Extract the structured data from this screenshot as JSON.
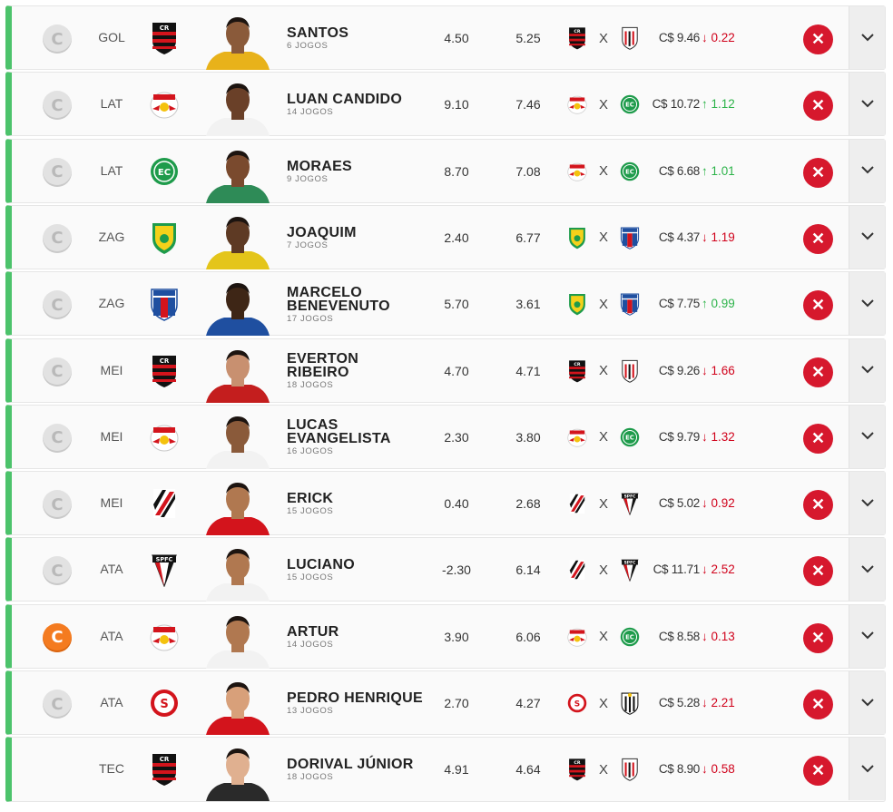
{
  "accent_color": "#4cc36b",
  "players": [
    {
      "pos": "GOL",
      "team": "flamengo",
      "name": "SANTOS",
      "games": "6 JOGOS",
      "v1": "4.50",
      "v2": "5.25",
      "home": "flamengo",
      "vs": "X",
      "away": "atletico-go",
      "price": "C$ 9.46",
      "variation": "0.22",
      "dir": "down",
      "captain": "off",
      "shirt": "#e8b21a",
      "skin": "#8a5a3a"
    },
    {
      "pos": "LAT",
      "team": "bragantino",
      "name": "LUAN CANDIDO",
      "games": "14 JOGOS",
      "v1": "9.10",
      "v2": "7.46",
      "home": "bragantino",
      "vs": "X",
      "away": "juventude",
      "price": "C$ 10.72",
      "variation": "1.12",
      "dir": "up",
      "captain": "off",
      "shirt": "#f2f2f2",
      "skin": "#6a4028"
    },
    {
      "pos": "LAT",
      "team": "juventude",
      "name": "MORAES",
      "games": "9 JOGOS",
      "v1": "8.70",
      "v2": "7.08",
      "home": "bragantino",
      "vs": "X",
      "away": "juventude",
      "price": "C$ 6.68",
      "variation": "1.01",
      "dir": "up",
      "captain": "off",
      "shirt": "#2e8b57",
      "skin": "#7a4a2e"
    },
    {
      "pos": "ZAG",
      "team": "cuiaba",
      "name": "JOAQUIM",
      "games": "7 JOGOS",
      "v1": "2.40",
      "v2": "6.77",
      "home": "cuiaba",
      "vs": "X",
      "away": "fortaleza",
      "price": "C$ 4.37",
      "variation": "1.19",
      "dir": "down",
      "captain": "off",
      "shirt": "#e4c51a",
      "skin": "#5e3a24"
    },
    {
      "pos": "ZAG",
      "team": "fortaleza",
      "name": "MARCELO BENEVENUTO",
      "games": "17 JOGOS",
      "v1": "5.70",
      "v2": "3.61",
      "home": "cuiaba",
      "vs": "X",
      "away": "fortaleza",
      "price": "C$ 7.75",
      "variation": "0.99",
      "dir": "up",
      "captain": "off",
      "shirt": "#1f4fa0",
      "skin": "#3e2616"
    },
    {
      "pos": "MEI",
      "team": "flamengo",
      "name": "EVERTON RIBEIRO",
      "games": "18 JOGOS",
      "v1": "4.70",
      "v2": "4.71",
      "home": "flamengo",
      "vs": "X",
      "away": "atletico-go",
      "price": "C$ 9.26",
      "variation": "1.66",
      "dir": "down",
      "captain": "off",
      "shirt": "#c41e1e",
      "skin": "#c89070"
    },
    {
      "pos": "MEI",
      "team": "bragantino",
      "name": "LUCAS EVANGELISTA",
      "games": "16 JOGOS",
      "v1": "2.30",
      "v2": "3.80",
      "home": "bragantino",
      "vs": "X",
      "away": "juventude",
      "price": "C$ 9.79",
      "variation": "1.32",
      "dir": "down",
      "captain": "off",
      "shirt": "#f2f2f2",
      "skin": "#8a5a3a"
    },
    {
      "pos": "MEI",
      "team": "athletico-pr",
      "name": "ERICK",
      "games": "15 JOGOS",
      "v1": "0.40",
      "v2": "2.68",
      "home": "athletico-pr",
      "vs": "X",
      "away": "sao-paulo",
      "price": "C$ 5.02",
      "variation": "0.92",
      "dir": "down",
      "captain": "off",
      "shirt": "#d3141c",
      "skin": "#b07850"
    },
    {
      "pos": "ATA",
      "team": "sao-paulo",
      "name": "LUCIANO",
      "games": "15 JOGOS",
      "v1": "-2.30",
      "v2": "6.14",
      "home": "athletico-pr",
      "vs": "X",
      "away": "sao-paulo",
      "price": "C$ 11.71",
      "variation": "2.52",
      "dir": "down",
      "captain": "off",
      "shirt": "#f2f2f2",
      "skin": "#b07850"
    },
    {
      "pos": "ATA",
      "team": "bragantino",
      "name": "ARTUR",
      "games": "14 JOGOS",
      "v1": "3.90",
      "v2": "6.06",
      "home": "bragantino",
      "vs": "X",
      "away": "juventude",
      "price": "C$ 8.58",
      "variation": "0.13",
      "dir": "down",
      "captain": "on",
      "shirt": "#f2f2f2",
      "skin": "#b07850"
    },
    {
      "pos": "ATA",
      "team": "internacional",
      "name": "PEDRO HENRIQUE",
      "games": "13 JOGOS",
      "v1": "2.70",
      "v2": "4.27",
      "home": "internacional",
      "vs": "X",
      "away": "atletico-mg",
      "price": "C$ 5.28",
      "variation": "2.21",
      "dir": "down",
      "captain": "off",
      "shirt": "#d3141c",
      "skin": "#d8a07a"
    },
    {
      "pos": "TEC",
      "team": "flamengo",
      "name": "DORIVAL JÚNIOR",
      "games": "18 JOGOS",
      "v1": "4.91",
      "v2": "4.64",
      "home": "flamengo",
      "vs": "X",
      "away": "atletico-go",
      "price": "C$ 8.90",
      "variation": "0.58",
      "dir": "down",
      "captain": "none",
      "shirt": "#2a2a2a",
      "skin": "#e0b090"
    }
  ]
}
